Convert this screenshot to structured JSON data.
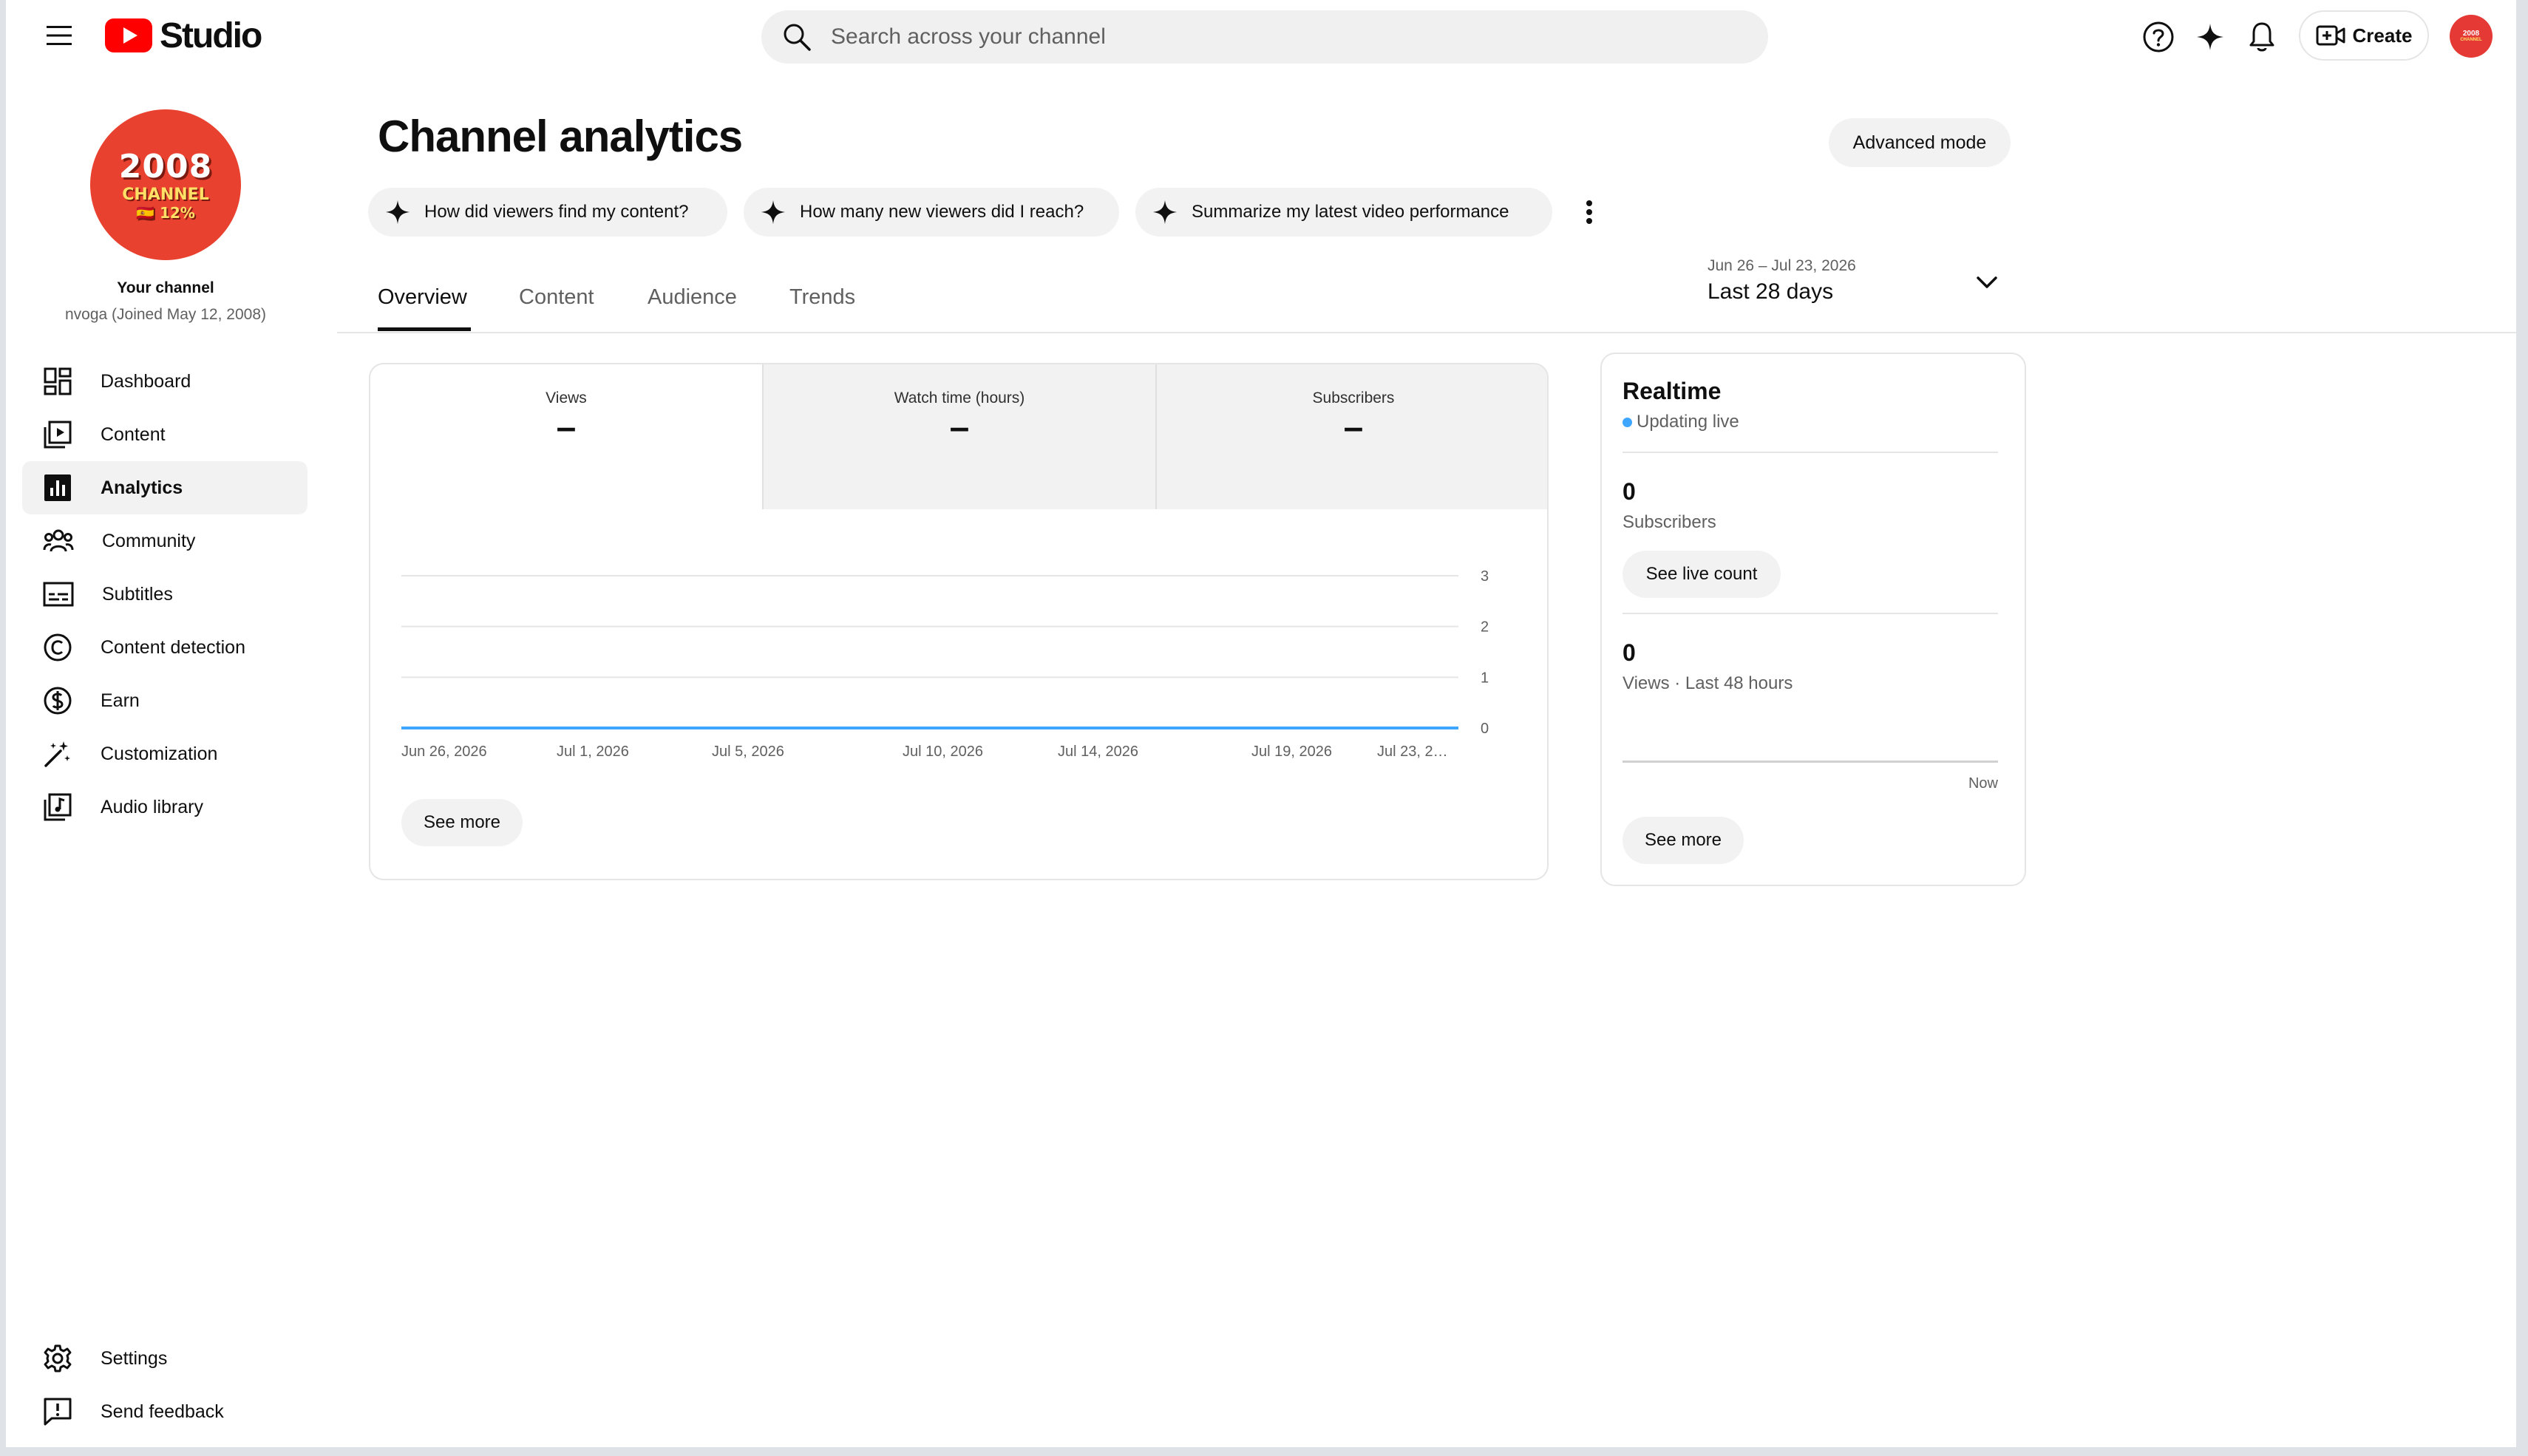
{
  "header": {
    "logo_text": "Studio",
    "search_placeholder": "Search across your channel",
    "create_label": "Create",
    "avatar_text_top": "2008",
    "avatar_text_bottom": "CHANNEL"
  },
  "sidebar": {
    "avatar": {
      "line1": "2008",
      "line2": "CHANNEL",
      "line3": "🇪🇸 12%"
    },
    "your_channel": "Your channel",
    "channel_sub": "nvoga (Joined May 12, 2008)",
    "items": [
      {
        "label": "Dashboard",
        "icon": "dashboard-icon"
      },
      {
        "label": "Content",
        "icon": "content-icon"
      },
      {
        "label": "Analytics",
        "icon": "analytics-icon",
        "active": true
      },
      {
        "label": "Community",
        "icon": "community-icon"
      },
      {
        "label": "Subtitles",
        "icon": "subtitles-icon"
      },
      {
        "label": "Content detection",
        "icon": "copyright-icon"
      },
      {
        "label": "Earn",
        "icon": "dollar-icon"
      },
      {
        "label": "Customization",
        "icon": "magic-wand-icon"
      },
      {
        "label": "Audio library",
        "icon": "audio-library-icon"
      }
    ],
    "bottom_items": [
      {
        "label": "Settings",
        "icon": "gear-icon"
      },
      {
        "label": "Send feedback",
        "icon": "feedback-icon"
      }
    ]
  },
  "main": {
    "title": "Channel analytics",
    "advanced_mode": "Advanced mode",
    "chips": [
      "How did viewers find my content?",
      "How many new viewers did I reach?",
      "Summarize my latest video performance"
    ],
    "tabs": [
      "Overview",
      "Content",
      "Audience",
      "Trends"
    ],
    "date_range": "Jun 26 – Jul 23, 2026",
    "date_preset": "Last 28 days",
    "metrics": [
      {
        "label": "Views",
        "value": "–"
      },
      {
        "label": "Watch time (hours)",
        "value": "–"
      },
      {
        "label": "Subscribers",
        "value": "–"
      }
    ],
    "see_more": "See more"
  },
  "chart_data": {
    "type": "line",
    "x": [
      "Jun 26, 2026",
      "Jul 1, 2026",
      "Jul 5, 2026",
      "Jul 10, 2026",
      "Jul 14, 2026",
      "Jul 19, 2026",
      "Jul 23, 2…"
    ],
    "series": [
      {
        "values": [
          0,
          0,
          0,
          0,
          0,
          0,
          0
        ]
      }
    ],
    "y_ticks": [
      "0",
      "1",
      "2",
      "3"
    ],
    "ylim": [
      0,
      3
    ],
    "grid": true,
    "line_color": "#3ea6ff"
  },
  "realtime": {
    "title": "Realtime",
    "live_text": "Updating live",
    "subscribers_value": "0",
    "subscribers_label": "Subscribers",
    "see_live_count": "See live count",
    "views_value": "0",
    "views_label": "Views · Last 48 hours",
    "now_label": "Now",
    "see_more": "See more"
  }
}
